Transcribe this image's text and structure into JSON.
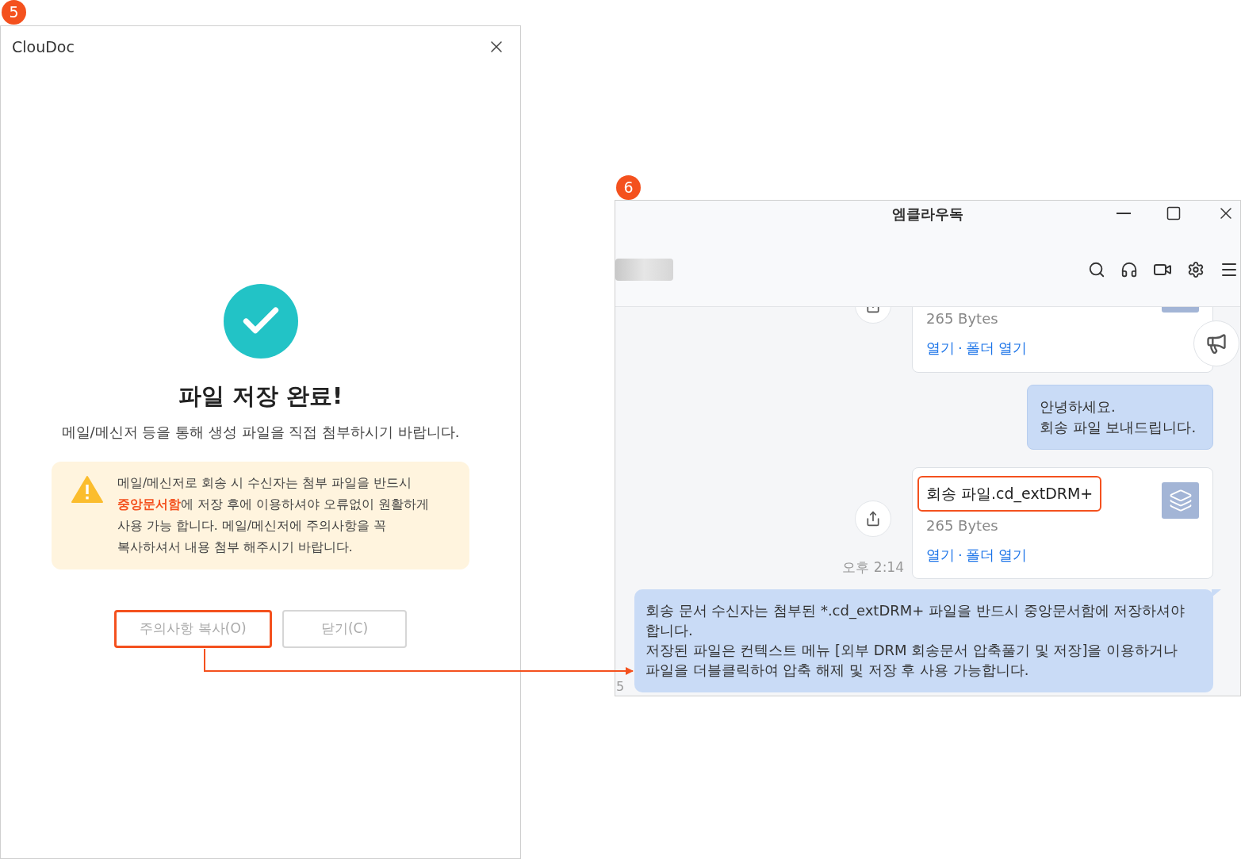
{
  "markers": [
    {
      "label": "5"
    },
    {
      "label": "6"
    }
  ],
  "dialog": {
    "title": "ClouDoc",
    "heading": "파일 저장 완료!",
    "subtitle": "메일/메신저 등을 통해 생성 파일을 직접 첨부하시기 바랍니다.",
    "warning": "메일/메신저로 회송 시 수신자는 첨부 파일을 반드시\n**중앙문서함**에 저장 후에 이용하셔야 오류없이 원활하게\n사용 가능 합니다. 메일/메신저에 주의사항을 꼭\n복사하셔서 내용 첨부 해주시기 바랍니다.",
    "buttons": [
      {
        "label": "주의사항 복사(O)",
        "highlighted": true
      },
      {
        "label": "닫기(C)",
        "highlighted": false
      }
    ]
  },
  "messenger": {
    "title": "엠클라우독",
    "messages": [
      {
        "kind": "file",
        "size": "265 Bytes",
        "open": "열기",
        "separator": "·",
        "open_folder": "폴더 열기"
      },
      {
        "kind": "text",
        "text": "안녕하세요.\n회송 파일 보내드립니다."
      },
      {
        "kind": "file",
        "name": "회송 파일.cd_extDRM+",
        "highlighted": true,
        "size": "265 Bytes",
        "open": "열기",
        "separator": "·",
        "open_folder": "폴더 열기",
        "time": "오후 2:14"
      },
      {
        "kind": "wide",
        "text": "회송 문서 수신자는 첨부된 *.cd_extDRM+ 파일을 반드시 중앙문서함에 저장하셔야\n합니다.\n저장된 파일은 컨텍스트 메뉴 [외부 DRM 회송문서 압축풀기 및 저장]을 이용하거나\n파일을 더블클릭하여 압축 해제 및 저장 후 사용 가능합니다.",
        "side_text": "5"
      }
    ]
  }
}
